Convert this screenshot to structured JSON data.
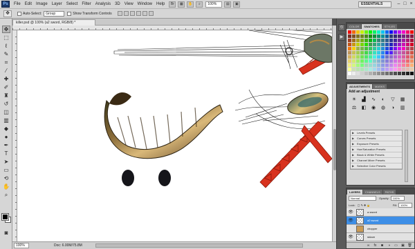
{
  "app": {
    "logo": "Ps",
    "menu": [
      "File",
      "Edit",
      "Image",
      "Layer",
      "Select",
      "Filter",
      "Analysis",
      "3D",
      "View",
      "Window",
      "Help"
    ],
    "zoom": "100%",
    "workspace": "ESSENTIALS"
  },
  "options": {
    "auto_select_label": "Auto-Select:",
    "auto_select_value": "Group",
    "show_transform_label": "Show Transform Controls"
  },
  "document": {
    "tab_title": "killer.psd @ 100% (a2 sword, RGB/8) *",
    "zoom": "100%",
    "doc_size": "Doc: 6.00M/75.8M"
  },
  "panels": {
    "swatch_tabs": [
      "COLOR",
      "SWATCHES",
      "STYLES"
    ],
    "adjust_tabs": [
      "ADJUSTMENTS",
      "MASKS"
    ],
    "adjust_title": "Add an adjustment",
    "presets": [
      "Levels Presets",
      "Curves Presets",
      "Exposure Presets",
      "Hue/Saturation Presets",
      "Black & White Presets",
      "Channel Mixer Presets",
      "Selective Color Presets"
    ],
    "layers_tabs": [
      "LAYERS",
      "CHANNELS",
      "PATHS"
    ],
    "blend_mode": "Normal",
    "opacity_label": "Opacity:",
    "opacity_value": "100%",
    "lock_label": "Lock:",
    "fill_label": "Fill:",
    "fill_value": "100%",
    "layers": [
      {
        "name": "a sword",
        "visible": true,
        "active": false,
        "thumb": "transparent"
      },
      {
        "name": "a2 sword",
        "visible": true,
        "active": true,
        "thumb": "transparent"
      },
      {
        "name": "chopper",
        "visible": false,
        "active": false,
        "thumb": "image"
      },
      {
        "name": "skizze",
        "visible": true,
        "active": false,
        "thumb": "transparent"
      }
    ]
  },
  "colors": {
    "accent": "#3d8ee6",
    "sword_red": "#d8321e"
  }
}
